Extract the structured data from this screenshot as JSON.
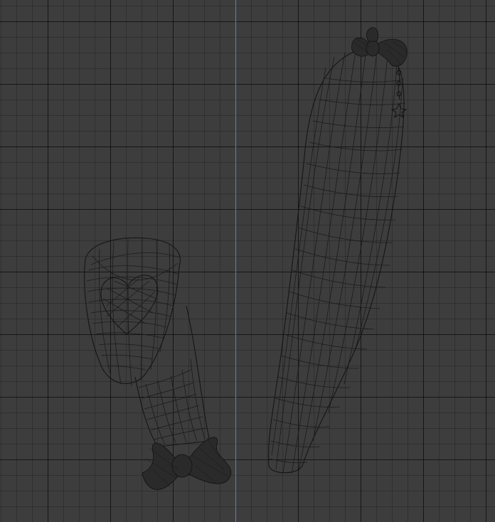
{
  "viewport": {
    "background_color": "#3d3d3d",
    "grid_line_color": "#2e2e2e",
    "y_axis_color": "#5a7fc4",
    "wire_color": "#1b1b1b"
  },
  "objects": [
    {
      "name": "left-leg-mesh",
      "icon": "wireframe-mesh-icon"
    },
    {
      "name": "right-leg-mesh",
      "icon": "wireframe-mesh-icon"
    }
  ]
}
